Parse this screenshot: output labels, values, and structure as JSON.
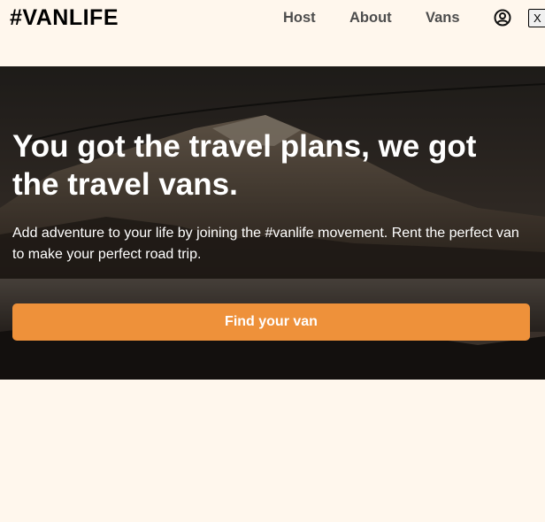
{
  "header": {
    "logo": "#VANLIFE",
    "nav": {
      "host": "Host",
      "about": "About",
      "vans": "Vans"
    },
    "user_icon": "user-circle-icon",
    "logout_label": "X"
  },
  "hero": {
    "title": "You got the travel plans, we got the travel vans.",
    "subtitle": "Add adventure to your life by joining the #vanlife movement. Rent the perfect van to make your perfect road trip.",
    "cta_label": "Find your van",
    "background": "mountain-lake-photo"
  },
  "colors": {
    "page_bg": "#FFF7ED",
    "accent": "#EE913A",
    "nav_text": "#4D4D4D",
    "hero_text": "#FFFFFF"
  }
}
